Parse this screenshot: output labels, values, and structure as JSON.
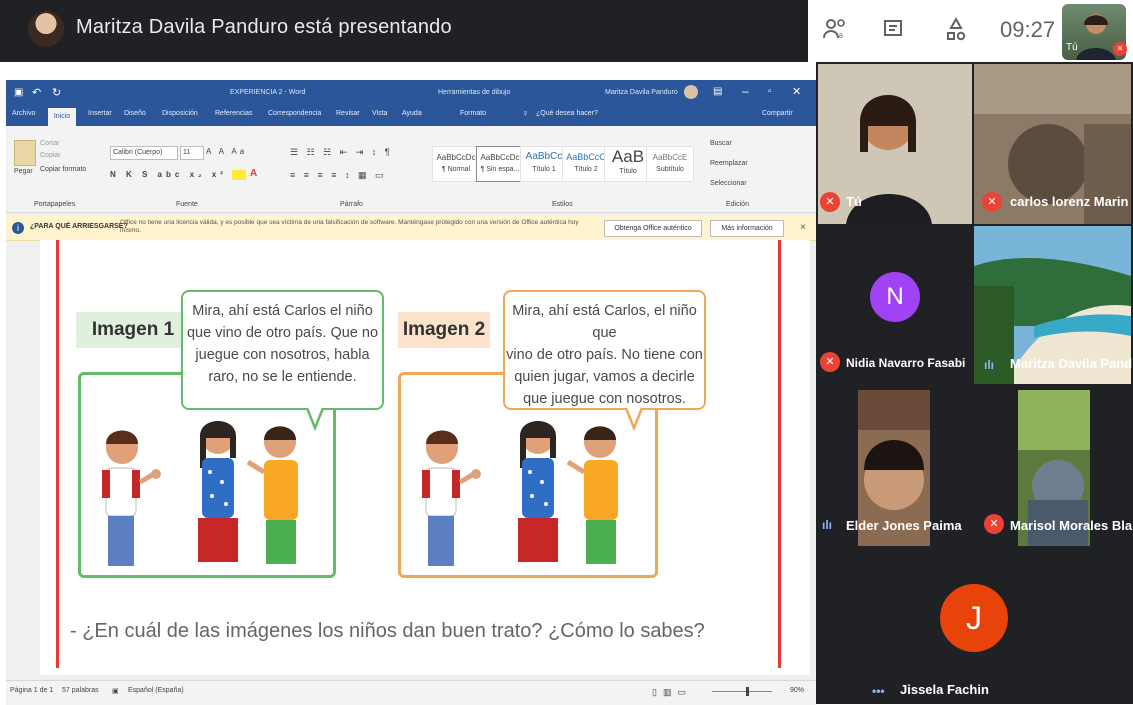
{
  "presenter": {
    "text": "Maritza Davila Panduro está presentando"
  },
  "meet_top": {
    "time": "09:27",
    "self_label": "Tú",
    "people_icon": "people-icon",
    "chat_icon": "chat-icon",
    "activities_icon": "activities-icon"
  },
  "word": {
    "title": "EXPERIENCIA 2 - Word",
    "tools_label": "Herramientas de dibujo",
    "user": "Maritza Davila Panduro",
    "tabs": [
      "Archivo",
      "Inicio",
      "Insertar",
      "Diseño",
      "Disposición",
      "Referencias",
      "Correspondencia",
      "Revisar",
      "Vista",
      "Ayuda",
      "Formato"
    ],
    "tell_me": "¿Qué desea hacer?",
    "share": "Compartir",
    "ribbon": {
      "paste": "Pegar",
      "cut": "Cortar",
      "copy": "Copiar",
      "format_painter": "Copiar formato",
      "font_name": "Calibri (Cuerpo)",
      "font_size": "11",
      "group_clipboard": "Portapapeles",
      "group_font": "Fuente",
      "group_paragraph": "Párrafo",
      "group_styles": "Estilos",
      "group_edit": "Edición",
      "styles": [
        {
          "preview": "AaBbCcDc",
          "name": "¶ Normal"
        },
        {
          "preview": "AaBbCcDc",
          "name": "¶ Sin espa..."
        },
        {
          "preview": "AaBbCc",
          "name": "Título 1"
        },
        {
          "preview": "AaBbCcC",
          "name": "Título 2"
        },
        {
          "preview": "AaB",
          "name": "Título"
        },
        {
          "preview": "AaBbCcE",
          "name": "Subtítulo"
        }
      ],
      "find": "Buscar",
      "replace": "Reemplazar",
      "select": "Seleccionar"
    },
    "warning": {
      "title": "¿PARA QUÉ ARRIESGARSE?",
      "message": "Office no tiene una licencia válida, y es posible que sea víctima de una falsificación de software. Manténgase protegido con una versión de Office auténtica hoy mismo.",
      "btn_genuine": "Obtenga Office auténtico",
      "btn_more": "Más información",
      "close": "×"
    },
    "status": {
      "page": "Página 1 de 1",
      "words": "57 palabras",
      "lang": "Español (España)",
      "zoom": "90%"
    }
  },
  "document": {
    "panel1": {
      "tag": "Imagen 1",
      "bubble": [
        "Mira, ahí está Carlos el niño",
        "que vino de otro país. Que no",
        "juegue con nosotros, habla",
        "raro, no se le entiende."
      ]
    },
    "panel2": {
      "tag": "Imagen 2",
      "bubble": [
        "Mira, ahí está Carlos, el niño que",
        "vino de otro país. No tiene con",
        "quien jugar, vamos a decirle",
        "que juegue con nosotros."
      ]
    },
    "question": "- ¿En cuál de las imágenes los niños dan buen trato? ¿Cómo lo sabes?"
  },
  "participants": [
    {
      "name": "Tú",
      "muted": true
    },
    {
      "name": "carlos lorenz Marin",
      "muted": true
    },
    {
      "name": "Nidia Navarro Fasabi",
      "muted": true,
      "initial": "N",
      "avatar_color": "#a142f4"
    },
    {
      "name": "Maritza Davila Pand...",
      "muted": false
    },
    {
      "name": "Elder Jones Paima",
      "muted": false
    },
    {
      "name": "Marisol Morales Bla...",
      "muted": true
    },
    {
      "name": "Jissela Fachin",
      "muted": false,
      "initial": "J",
      "avatar_color": "#e8430a"
    }
  ],
  "colors": {
    "word_blue": "#2b579a",
    "meet_bg": "#202124",
    "mute_red": "#ea4335",
    "green": "#66bb6a",
    "orange": "#f2a65a"
  }
}
